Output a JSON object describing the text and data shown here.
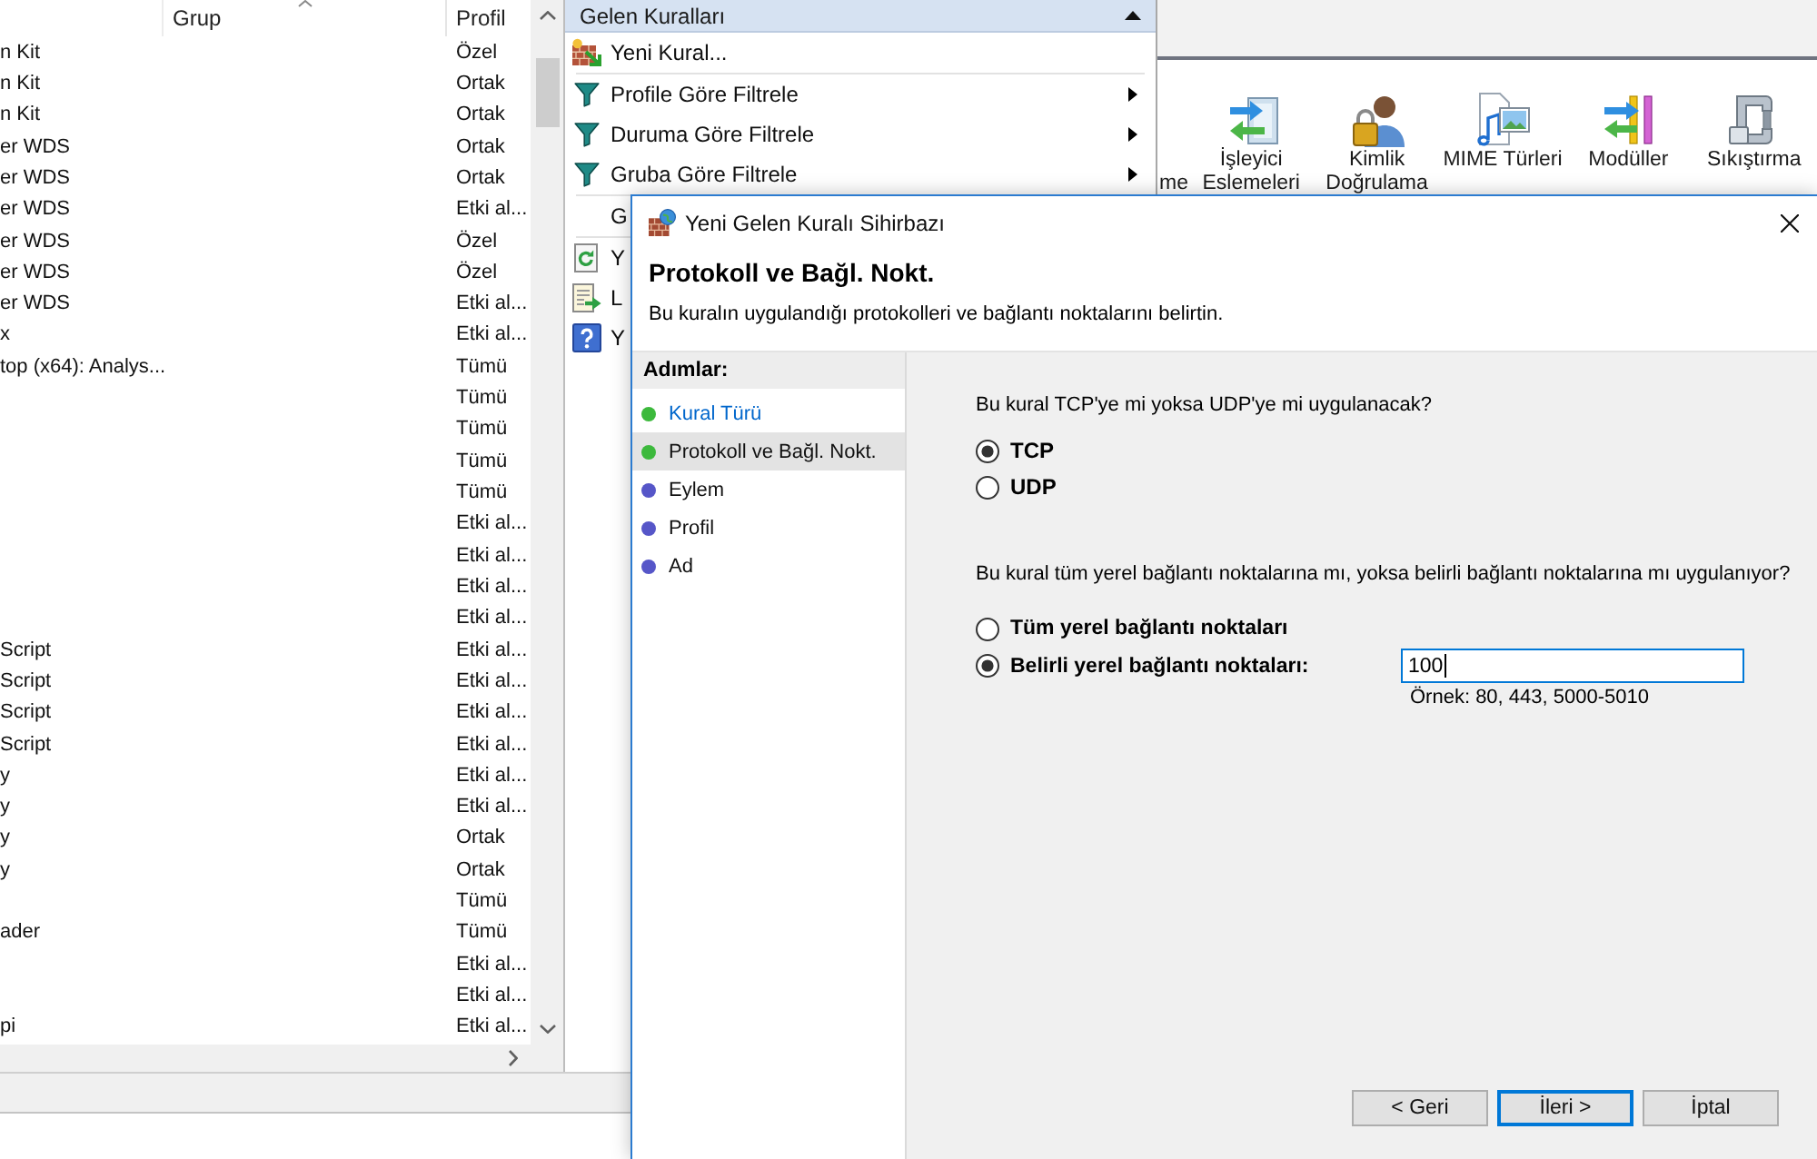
{
  "rules_list": {
    "columns": [
      {
        "label": "Grup"
      },
      {
        "label": "Profil"
      }
    ],
    "rows": [
      {
        "column_1": "n Kit",
        "profil": "Özel"
      },
      {
        "column_1": "n Kit",
        "profil": "Ortak"
      },
      {
        "column_1": "n Kit",
        "profil": "Ortak"
      },
      {
        "column_1": "er WDS",
        "profil": "Ortak"
      },
      {
        "column_1": "er WDS",
        "profil": "Ortak"
      },
      {
        "column_1": "er WDS",
        "profil": "Etki al..."
      },
      {
        "column_1": "er WDS",
        "profil": "Özel"
      },
      {
        "column_1": "er WDS",
        "profil": "Özel"
      },
      {
        "column_1": "er WDS",
        "profil": "Etki al..."
      },
      {
        "column_1": "x",
        "profil": "Etki al..."
      },
      {
        "column_1": "top (x64): Analys...",
        "profil": "Tümü"
      },
      {
        "profil": "Tümü"
      },
      {
        "profil": "Tümü"
      },
      {
        "profil": "Tümü"
      },
      {
        "profil": "Tümü"
      },
      {
        "profil": "Etki al..."
      },
      {
        "profil": "Etki al..."
      },
      {
        "profil": "Etki al..."
      },
      {
        "profil": "Etki al..."
      },
      {
        "column_1": "Script",
        "profil": "Etki al..."
      },
      {
        "column_1": "Script",
        "profil": "Etki al..."
      },
      {
        "column_1": "Script",
        "profil": "Etki al..."
      },
      {
        "column_1": "Script",
        "profil": "Etki al..."
      },
      {
        "column_1": "y",
        "profil": "Etki al..."
      },
      {
        "column_1": "y",
        "profil": "Etki al..."
      },
      {
        "column_1": "y",
        "profil": "Ortak"
      },
      {
        "column_1": "y",
        "profil": "Ortak"
      },
      {
        "profil": "Tümü"
      },
      {
        "column_1": "ader",
        "profil": "Tümü"
      },
      {
        "profil": "Etki al..."
      },
      {
        "profil": "Etki al..."
      },
      {
        "column_1": "pi",
        "profil": "Etki al..."
      }
    ]
  },
  "actions_pane": {
    "title": "Gelen Kuralları",
    "expanded": true,
    "items": [
      {
        "kind": "newrule",
        "label": "Yeni Kural...",
        "submenu": false
      },
      {
        "kind": "separator"
      },
      {
        "kind": "filter",
        "label": "Profile Göre Filtrele",
        "submenu": true
      },
      {
        "kind": "filter",
        "label": "Duruma Göre Filtrele",
        "submenu": true
      },
      {
        "kind": "filter",
        "label": "Gruba Göre Filtrele",
        "submenu": true
      },
      {
        "kind": "separator"
      },
      {
        "kind": "plain",
        "label": "G",
        "submenu": false
      },
      {
        "kind": "separator"
      },
      {
        "kind": "refresh",
        "label": "Y",
        "submenu": false
      },
      {
        "kind": "export",
        "label": "L",
        "submenu": false
      },
      {
        "kind": "help",
        "label": "Y",
        "submenu": false
      }
    ]
  },
  "iis_features": {
    "items": [
      {
        "kind": "hidden",
        "label": "me"
      },
      {
        "kind": "arrows",
        "label": "İşleyici Eslemeleri"
      },
      {
        "kind": "userlock",
        "label": "Kimlik Doğrulama"
      },
      {
        "kind": "media",
        "label": "MIME Türleri"
      },
      {
        "kind": "modules",
        "label": "Modüller"
      },
      {
        "kind": "clamp",
        "label": "Sıkıştırma"
      }
    ]
  },
  "wizard": {
    "title": "Yeni Gelen Kuralı Sihirbazı",
    "heading": "Protokoll ve Bağl. Nokt.",
    "description": "Bu kuralın uygulandığı protokolleri ve bağlantı noktalarını belirtin.",
    "steps_title": "Adımlar:",
    "steps": [
      {
        "label": "Kural Türü",
        "selected": false,
        "link": true,
        "color": "#3cb93c"
      },
      {
        "label": "Protokoll ve Bağl. Nokt.",
        "selected": true,
        "link": false,
        "color": "#3cb93c"
      },
      {
        "label": "Eylem",
        "selected": false,
        "link": false,
        "color": "#5656c8"
      },
      {
        "label": "Profil",
        "selected": false,
        "link": false,
        "color": "#5656c8"
      },
      {
        "label": "Ad",
        "selected": false,
        "link": false,
        "color": "#5656c8"
      }
    ],
    "protocol_question": "Bu kural TCP'ye mi yoksa UDP'ye mi uygulanacak?",
    "protocol_options": [
      {
        "label": "TCP",
        "selected": true
      },
      {
        "label": "UDP",
        "selected": false
      }
    ],
    "port_question": "Bu kural tüm yerel bağlantı noktalarına mı, yoksa belirli bağlantı noktalarına mı uygulanıyor?",
    "port_options": [
      {
        "label": "Tüm yerel bağlantı noktaları",
        "selected": false
      },
      {
        "label": "Belirli yerel bağlantı noktaları:",
        "selected": true
      }
    ],
    "port_field": {
      "value": "100",
      "focused": true
    },
    "port_hint": "Örnek: 80, 443, 5000-5010",
    "buttons": [
      {
        "label": "< Geri",
        "default": false
      },
      {
        "label": "İleri >",
        "default": true
      },
      {
        "label": "İptal",
        "default": false
      }
    ]
  }
}
